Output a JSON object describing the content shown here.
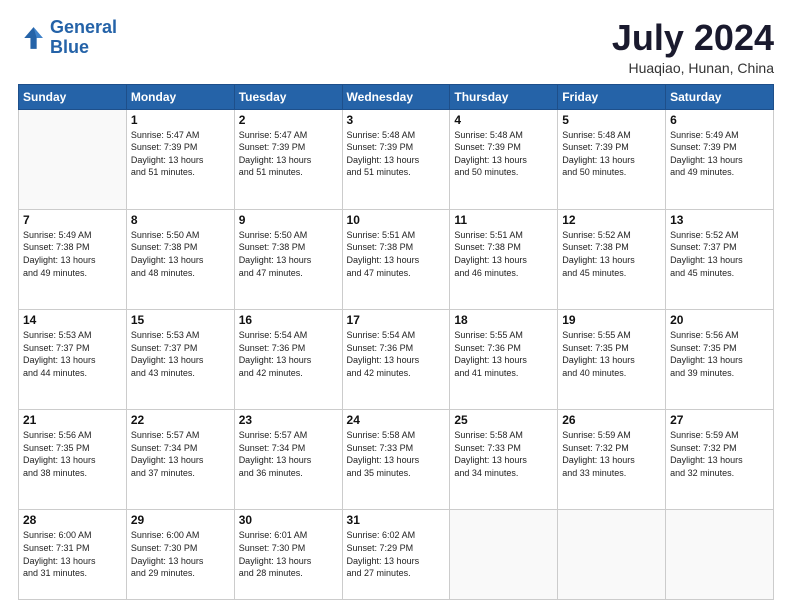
{
  "header": {
    "logo_line1": "General",
    "logo_line2": "Blue",
    "month_year": "July 2024",
    "location": "Huaqiao, Hunan, China"
  },
  "weekdays": [
    "Sunday",
    "Monday",
    "Tuesday",
    "Wednesday",
    "Thursday",
    "Friday",
    "Saturday"
  ],
  "weeks": [
    [
      {
        "day": "",
        "info": ""
      },
      {
        "day": "1",
        "info": "Sunrise: 5:47 AM\nSunset: 7:39 PM\nDaylight: 13 hours\nand 51 minutes."
      },
      {
        "day": "2",
        "info": "Sunrise: 5:47 AM\nSunset: 7:39 PM\nDaylight: 13 hours\nand 51 minutes."
      },
      {
        "day": "3",
        "info": "Sunrise: 5:48 AM\nSunset: 7:39 PM\nDaylight: 13 hours\nand 51 minutes."
      },
      {
        "day": "4",
        "info": "Sunrise: 5:48 AM\nSunset: 7:39 PM\nDaylight: 13 hours\nand 50 minutes."
      },
      {
        "day": "5",
        "info": "Sunrise: 5:48 AM\nSunset: 7:39 PM\nDaylight: 13 hours\nand 50 minutes."
      },
      {
        "day": "6",
        "info": "Sunrise: 5:49 AM\nSunset: 7:39 PM\nDaylight: 13 hours\nand 49 minutes."
      }
    ],
    [
      {
        "day": "7",
        "info": "Sunrise: 5:49 AM\nSunset: 7:38 PM\nDaylight: 13 hours\nand 49 minutes."
      },
      {
        "day": "8",
        "info": "Sunrise: 5:50 AM\nSunset: 7:38 PM\nDaylight: 13 hours\nand 48 minutes."
      },
      {
        "day": "9",
        "info": "Sunrise: 5:50 AM\nSunset: 7:38 PM\nDaylight: 13 hours\nand 47 minutes."
      },
      {
        "day": "10",
        "info": "Sunrise: 5:51 AM\nSunset: 7:38 PM\nDaylight: 13 hours\nand 47 minutes."
      },
      {
        "day": "11",
        "info": "Sunrise: 5:51 AM\nSunset: 7:38 PM\nDaylight: 13 hours\nand 46 minutes."
      },
      {
        "day": "12",
        "info": "Sunrise: 5:52 AM\nSunset: 7:38 PM\nDaylight: 13 hours\nand 45 minutes."
      },
      {
        "day": "13",
        "info": "Sunrise: 5:52 AM\nSunset: 7:37 PM\nDaylight: 13 hours\nand 45 minutes."
      }
    ],
    [
      {
        "day": "14",
        "info": "Sunrise: 5:53 AM\nSunset: 7:37 PM\nDaylight: 13 hours\nand 44 minutes."
      },
      {
        "day": "15",
        "info": "Sunrise: 5:53 AM\nSunset: 7:37 PM\nDaylight: 13 hours\nand 43 minutes."
      },
      {
        "day": "16",
        "info": "Sunrise: 5:54 AM\nSunset: 7:36 PM\nDaylight: 13 hours\nand 42 minutes."
      },
      {
        "day": "17",
        "info": "Sunrise: 5:54 AM\nSunset: 7:36 PM\nDaylight: 13 hours\nand 42 minutes."
      },
      {
        "day": "18",
        "info": "Sunrise: 5:55 AM\nSunset: 7:36 PM\nDaylight: 13 hours\nand 41 minutes."
      },
      {
        "day": "19",
        "info": "Sunrise: 5:55 AM\nSunset: 7:35 PM\nDaylight: 13 hours\nand 40 minutes."
      },
      {
        "day": "20",
        "info": "Sunrise: 5:56 AM\nSunset: 7:35 PM\nDaylight: 13 hours\nand 39 minutes."
      }
    ],
    [
      {
        "day": "21",
        "info": "Sunrise: 5:56 AM\nSunset: 7:35 PM\nDaylight: 13 hours\nand 38 minutes."
      },
      {
        "day": "22",
        "info": "Sunrise: 5:57 AM\nSunset: 7:34 PM\nDaylight: 13 hours\nand 37 minutes."
      },
      {
        "day": "23",
        "info": "Sunrise: 5:57 AM\nSunset: 7:34 PM\nDaylight: 13 hours\nand 36 minutes."
      },
      {
        "day": "24",
        "info": "Sunrise: 5:58 AM\nSunset: 7:33 PM\nDaylight: 13 hours\nand 35 minutes."
      },
      {
        "day": "25",
        "info": "Sunrise: 5:58 AM\nSunset: 7:33 PM\nDaylight: 13 hours\nand 34 minutes."
      },
      {
        "day": "26",
        "info": "Sunrise: 5:59 AM\nSunset: 7:32 PM\nDaylight: 13 hours\nand 33 minutes."
      },
      {
        "day": "27",
        "info": "Sunrise: 5:59 AM\nSunset: 7:32 PM\nDaylight: 13 hours\nand 32 minutes."
      }
    ],
    [
      {
        "day": "28",
        "info": "Sunrise: 6:00 AM\nSunset: 7:31 PM\nDaylight: 13 hours\nand 31 minutes."
      },
      {
        "day": "29",
        "info": "Sunrise: 6:00 AM\nSunset: 7:30 PM\nDaylight: 13 hours\nand 29 minutes."
      },
      {
        "day": "30",
        "info": "Sunrise: 6:01 AM\nSunset: 7:30 PM\nDaylight: 13 hours\nand 28 minutes."
      },
      {
        "day": "31",
        "info": "Sunrise: 6:02 AM\nSunset: 7:29 PM\nDaylight: 13 hours\nand 27 minutes."
      },
      {
        "day": "",
        "info": ""
      },
      {
        "day": "",
        "info": ""
      },
      {
        "day": "",
        "info": ""
      }
    ]
  ]
}
